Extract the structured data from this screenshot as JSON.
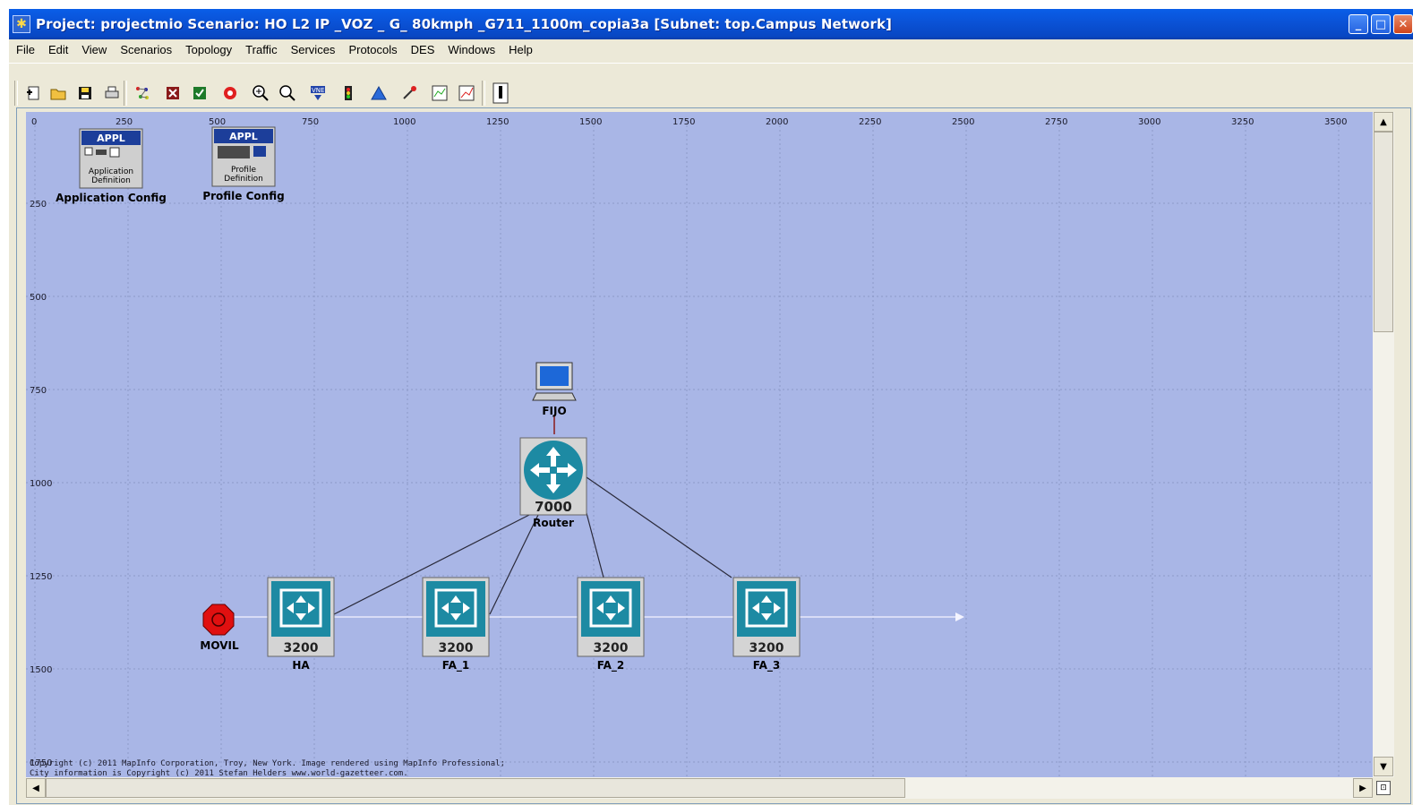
{
  "window": {
    "title": "Project: projectmio Scenario: HO L2  IP _VOZ _ G_ 80kmph _G711_1100m_copia3a  [Subnet: top.Campus Network]",
    "app_icon": "star-icon",
    "controls": [
      "minimize-icon",
      "maximize-icon",
      "close-icon"
    ]
  },
  "menu": [
    "File",
    "Edit",
    "View",
    "Scenarios",
    "Topology",
    "Traffic",
    "Services",
    "Protocols",
    "DES",
    "Windows",
    "Help"
  ],
  "toolbar": {
    "icons": [
      "new-project-icon",
      "open-folder-icon",
      "save-icon",
      "print-icon",
      "object-palette-icon",
      "configure-node-icon",
      "verify-links-icon",
      "failure-recovery-icon",
      "zoom-in-icon",
      "zoom-out-icon",
      "vne-import-icon",
      "traffic-light-icon",
      "run-simulation-icon",
      "results-icon",
      "view-results-icon",
      "graph-icon",
      "info-icon"
    ]
  },
  "ruler": {
    "x_ticks": [
      "0",
      "250",
      "500",
      "750",
      "1000",
      "1250",
      "1500",
      "1750",
      "2000",
      "2250",
      "2500",
      "2750",
      "3000",
      "3250",
      "3500"
    ],
    "y_ticks": [
      "250",
      "500",
      "750",
      "1000",
      "1250",
      "1500",
      "1750"
    ]
  },
  "config_objects": [
    {
      "header": "APPL",
      "caption_line1": "Application",
      "caption_line2": "Definition",
      "label": "Application Config"
    },
    {
      "header": "APPL",
      "caption_line1": "Profile",
      "caption_line2": "Definition",
      "label": "Profile Config"
    }
  ],
  "nodes": {
    "workstation": {
      "label": "FIJO"
    },
    "router": {
      "model": "7000",
      "label": "Router"
    },
    "mobile": {
      "label": "MOVIL"
    },
    "switches": [
      {
        "model": "3200",
        "label": "HA"
      },
      {
        "model": "3200",
        "label": "FA_1"
      },
      {
        "model": "3200",
        "label": "FA_2"
      },
      {
        "model": "3200",
        "label": "FA_3"
      }
    ]
  },
  "copyright": {
    "line1": "Copyright (c) 2011 MapInfo Corporation, Troy, New York. Image rendered using MapInfo Professional;",
    "line2": "City information is Copyright (c) 2011 Stefan Helders www.world-gazetteer.com."
  },
  "colors": {
    "canvas": "#a9b6e6",
    "titlebar": "#0a53d8",
    "router_teal": "#1d8aa3",
    "mobile_red": "#e01010"
  }
}
